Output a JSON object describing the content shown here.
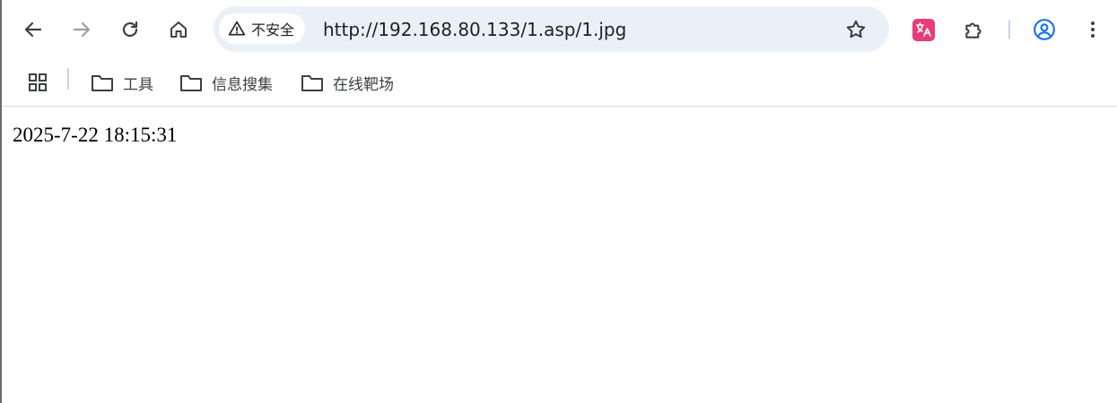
{
  "toolbar": {
    "security_label": "不安全",
    "url": "http://192.168.80.133/1.asp/1.jpg",
    "icons": [
      "back-icon",
      "forward-icon",
      "reload-icon",
      "home-icon",
      "warning-icon",
      "star-icon",
      "translate-extension-icon",
      "extensions-puzzle-icon",
      "profile-icon",
      "menu-icon"
    ]
  },
  "bookmarks": {
    "items": [
      {
        "label": "工具"
      },
      {
        "label": "信息搜集"
      },
      {
        "label": "在线靶场"
      }
    ]
  },
  "page": {
    "text": "2025-7-22 18:15:31"
  },
  "colors": {
    "omnibox_bg": "#ebf0f8",
    "translate_ext": "#e63d7a",
    "profile_blue": "#1a73e8"
  }
}
